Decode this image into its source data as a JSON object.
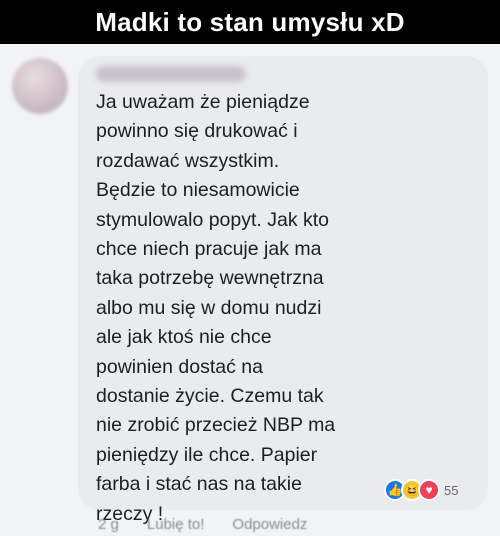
{
  "meme": {
    "title": "Madki to stan umysłu xD"
  },
  "comment": {
    "text": "Ja uważam że pieniądze\npowinno się drukować i\nrozdawać wszystkim.\nBędzie to niesamowicie\nstymulowalo popyt. Jak kto\nchce niech pracuje jak ma\ntaka potrzebę wewnętrzna\nalbo mu się w domu nudzi\nale jak ktoś nie chce\npowinien dostać na\ndostanie życie. Czemu tak\nnie zrobić przecież NBP ma\npieniędzy ile chce. Papier\nfarba i stać nas na takie\nrzeczy !",
    "reactions": {
      "icons": [
        "like-icon",
        "haha-icon",
        "love-icon"
      ],
      "count": "55"
    },
    "actions": {
      "time": "2 g",
      "like_label": "Lubię to!",
      "reply_label": "Odpowiedz"
    }
  },
  "colors": {
    "title_bg": "#000000",
    "bubble_bg": "#e9ebee",
    "text": "#1c1e21",
    "like": "#1877f2",
    "haha": "#f7c339",
    "love": "#f0405a"
  }
}
